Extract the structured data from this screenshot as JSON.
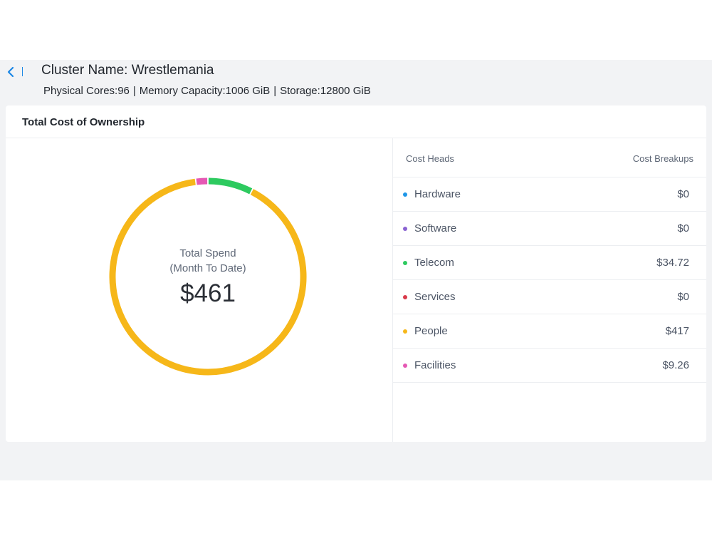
{
  "header": {
    "cluster_title": "Cluster Name: Wrestlemania",
    "physical_cores": "Physical Cores:96",
    "memory_capacity": "Memory Capacity:1006 GiB",
    "storage": "Storage:12800 GiB",
    "separator": "|"
  },
  "card": {
    "title": "Total Cost of Ownership"
  },
  "donut": {
    "label_line1": "Total Spend",
    "label_line2": "(Month To Date)",
    "total": "$461"
  },
  "table": {
    "col_heads": "Cost Heads",
    "col_breakups": "Cost Breakups",
    "rows": [
      {
        "name": "Hardware",
        "value": "$0",
        "color": "#1e96e8"
      },
      {
        "name": "Software",
        "value": "$0",
        "color": "#8a63d2"
      },
      {
        "name": "Telecom",
        "value": "$34.72",
        "color": "#2dca5f"
      },
      {
        "name": "Services",
        "value": "$0",
        "color": "#d93a4a"
      },
      {
        "name": "People",
        "value": "$417",
        "color": "#f6b719"
      },
      {
        "name": "Facilities",
        "value": "$9.26",
        "color": "#e558b4"
      }
    ]
  },
  "chart_data": {
    "type": "pie",
    "categories": [
      "Hardware",
      "Software",
      "Telecom",
      "Services",
      "People",
      "Facilities"
    ],
    "values": [
      0,
      0,
      34.72,
      0,
      417,
      9.26
    ],
    "colors": [
      "#1e96e8",
      "#8a63d2",
      "#2dca5f",
      "#d93a4a",
      "#f6b719",
      "#e558b4"
    ],
    "style": "donut"
  }
}
